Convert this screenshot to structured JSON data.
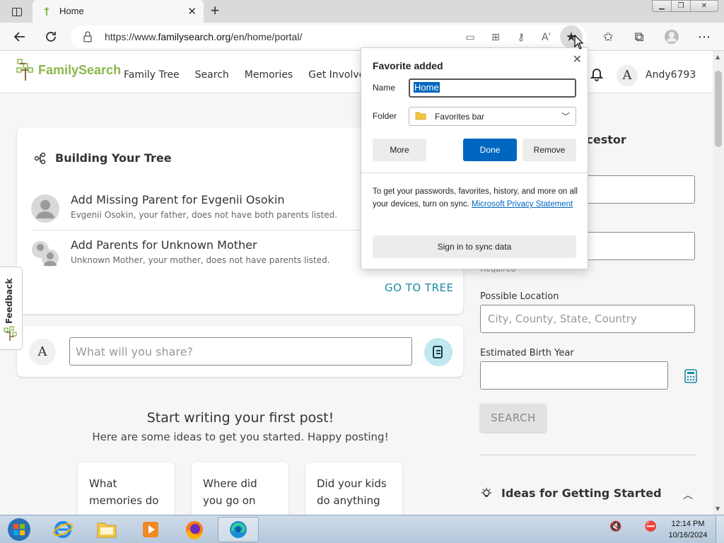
{
  "browser": {
    "tab_title": "Home",
    "new_tab": "+",
    "url_prefix": "https://www.",
    "url_host": "familysearch.org",
    "url_path": "/en/home/portal/"
  },
  "header": {
    "logo_text": "FamilySearch",
    "nav": [
      "Family Tree",
      "Search",
      "Memories",
      "Get Involved"
    ],
    "avatar_letter": "A",
    "username": "Andy6793"
  },
  "tree_card": {
    "title": "Building Your Tree",
    "tasks": [
      {
        "title": "Add Missing Parent for Evgenii Osokin",
        "subtitle": "Evgenii Osokin, your father, does not have both parents listed."
      },
      {
        "title": "Add Parents for Unknown Mother",
        "subtitle": "Unknown Mother, your mother, does not have parents listed."
      }
    ],
    "goto": "GO TO TREE"
  },
  "share": {
    "avatar_letter": "A",
    "placeholder": "What will you share?"
  },
  "start": {
    "title": "Start writing your first post!",
    "subtitle": "Here are some ideas to get you started. Happy posting!",
    "ideas": [
      "What memories do",
      "Where did you go on",
      "Did your kids do anything"
    ]
  },
  "sidebar": {
    "ancestor_heading_fragment": "ncestor",
    "required": "Required",
    "location_label": "Possible Location",
    "location_placeholder": "City, County, State, Country",
    "birth_label": "Estimated Birth Year",
    "search_label": "SEARCH",
    "ideas_heading": "Ideas for Getting Started"
  },
  "feedback": "Feedback",
  "favorite_popup": {
    "title": "Favorite added",
    "name_label": "Name",
    "name_value": "Home",
    "folder_label": "Folder",
    "folder_value": "Favorites bar",
    "more": "More",
    "done": "Done",
    "remove": "Remove",
    "info_text": "To get your passwords, favorites, history, and more on all your devices, turn on sync.",
    "info_link": "Microsoft Privacy Statement",
    "sync_button": "Sign in to sync data"
  },
  "taskbar": {
    "time": "12:14 PM",
    "date": "10/16/2024"
  },
  "colors": {
    "brand_green": "#8ab84a",
    "link_teal": "#1a8ba3",
    "edge_blue": "#0067c0"
  }
}
